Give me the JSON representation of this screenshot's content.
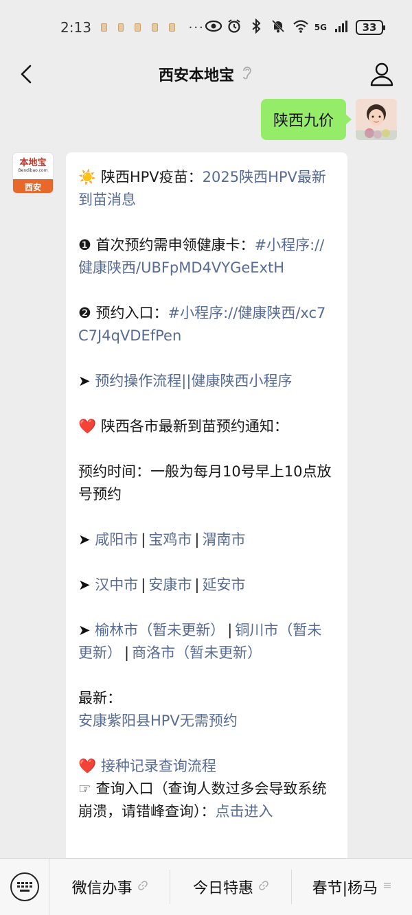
{
  "status_bar": {
    "time": "2:13",
    "more": "···",
    "network": "5G",
    "battery": "33"
  },
  "nav": {
    "title": "西安本地宝"
  },
  "outgoing_message": {
    "text": "陕西九价"
  },
  "bot_avatar": {
    "logo_cn": "本地宝",
    "logo_en": "Bendibao.com",
    "city": "西安"
  },
  "reply": {
    "title_prefix": "☀️ 陕西HPV疫苗：",
    "title_link": "2025陕西HPV最新到苗消息",
    "step1_prefix": "❶ 首次预约需申领健康卡：",
    "step1_link": "#小程序://健康陕西/UBFpMD4VYGeExtH",
    "step2_prefix": "❷ 预约入口：",
    "step2_link": "#小程序://健康陕西/xc7C7J4qVDEfPen",
    "arrow": "➤",
    "flow_link": "预约操作流程||健康陕西小程序",
    "heart": "❤️",
    "notice_heading": "陕西各市最新到苗预约通知：",
    "time_text": "预约时间：一般为每月10号早上10点放号预约",
    "sep": "|",
    "cities_row1": [
      "咸阳市",
      "宝鸡市",
      "渭南市"
    ],
    "cities_row2": [
      "汉中市",
      "安康市",
      "延安市"
    ],
    "cities_row3": [
      "榆林市（暂未更新）",
      "铜川市（暂未更新）",
      "商洛市（暂未更新）"
    ],
    "latest_label": "最新：",
    "latest_link": "安康紫阳县HPV无需预约",
    "record_link": "接种记录查询流程",
    "query_hand": "☞",
    "query_text": "查询入口（查询人数过多会导致系统崩溃，请错峰查询）：",
    "query_link": "点击进入"
  },
  "bottom_menu": {
    "items": [
      "微信办事",
      "今日特惠",
      "春节|杨马"
    ]
  }
}
